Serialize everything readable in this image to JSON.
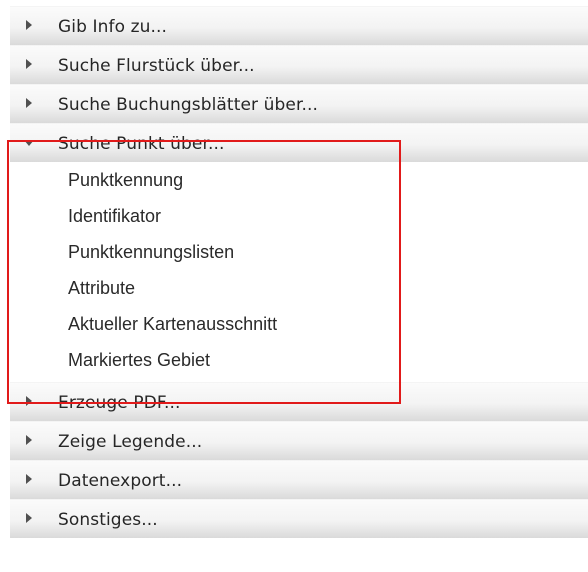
{
  "menu": {
    "items": [
      {
        "label": "Gib Info zu...",
        "expanded": false
      },
      {
        "label": "Suche Flurstück über...",
        "expanded": false
      },
      {
        "label": "Suche Buchungsblätter über...",
        "expanded": false
      },
      {
        "label": "Suche Punkt über...",
        "expanded": true
      },
      {
        "label": "Erzeuge PDF...",
        "expanded": false
      },
      {
        "label": "Zeige Legende...",
        "expanded": false
      },
      {
        "label": "Datenexport...",
        "expanded": false
      },
      {
        "label": "Sonstiges...",
        "expanded": false
      }
    ],
    "punkt_subitems": [
      "Punktkennung",
      "Identifikator",
      "Punktkennungslisten",
      "Attribute",
      "Aktueller Kartenausschnitt",
      "Markiertes Gebiet"
    ]
  },
  "highlight_color": "#e11a1a"
}
